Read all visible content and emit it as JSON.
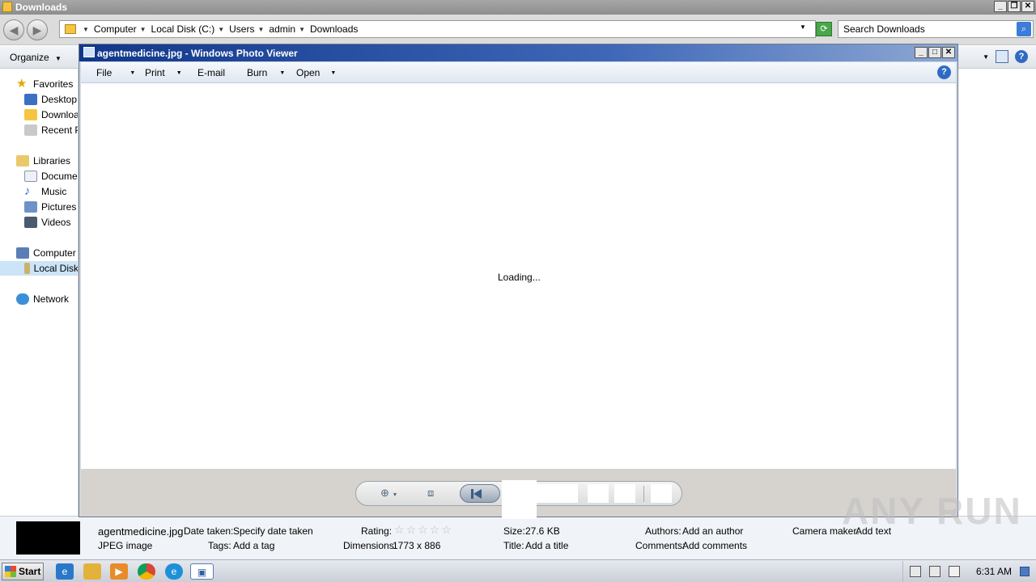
{
  "explorer": {
    "title": "Downloads",
    "breadcrumbs": [
      "Computer",
      "Local Disk (C:)",
      "Users",
      "admin",
      "Downloads"
    ],
    "search_placeholder": "Search Downloads",
    "organize_label": "Organize",
    "sidebar": {
      "favorites": "Favorites",
      "desktop": "Desktop",
      "downloads": "Downloac",
      "recent": "Recent Pl",
      "libraries": "Libraries",
      "documents": "Documen",
      "music": "Music",
      "pictures": "Pictures",
      "videos": "Videos",
      "computer": "Computer",
      "local_disk": "Local Disk",
      "network": "Network"
    },
    "details": {
      "filename": "agentmedicine.jpg",
      "filetype": "JPEG image",
      "date_taken_label": "Date taken:",
      "date_taken_value": "Specify date taken",
      "tags_label": "Tags:",
      "tags_value": "Add a tag",
      "rating_label": "Rating:",
      "dimensions_label": "Dimensions:",
      "dimensions_value": "1773 x 886",
      "size_label": "Size:",
      "size_value": "27.6 KB",
      "title_label": "Title:",
      "title_value": "Add a title",
      "authors_label": "Authors:",
      "authors_value": "Add an author",
      "comments_label": "Comments:",
      "comments_value": "Add comments",
      "camera_label": "Camera maker:",
      "camera_value": "Add text"
    }
  },
  "photo_viewer": {
    "title": "agentmedicine.jpg - Windows Photo Viewer",
    "menu": {
      "file": "File",
      "print": "Print",
      "email": "E-mail",
      "burn": "Burn",
      "open": "Open"
    },
    "status": "Loading..."
  },
  "taskbar": {
    "start_label": "Start",
    "clock": "6:31 AM"
  },
  "watermark": "ANY RUN"
}
